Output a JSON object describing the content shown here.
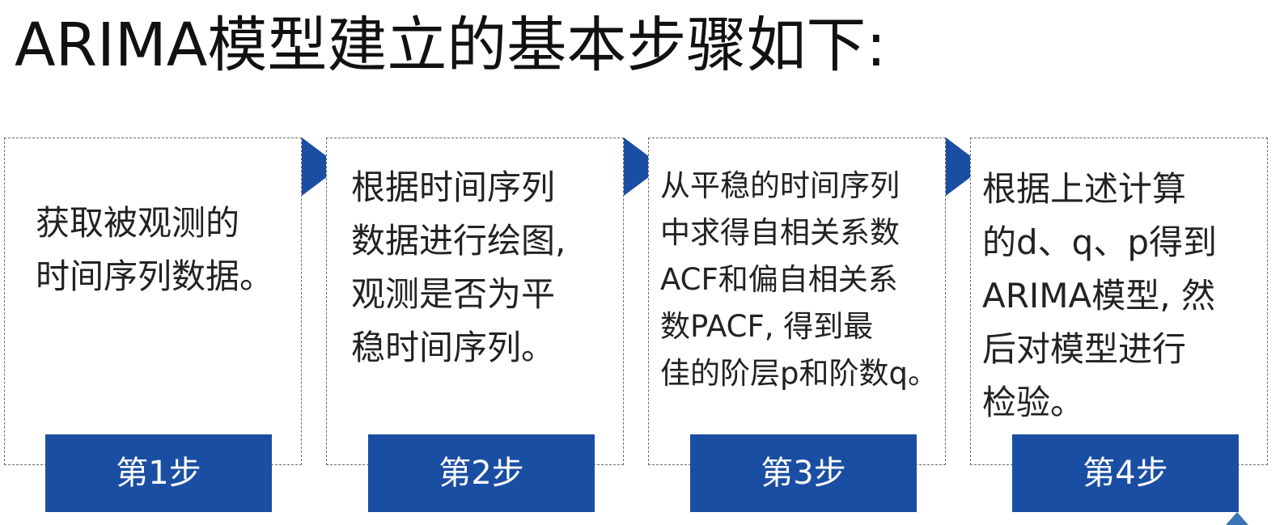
{
  "title": "ARIMA模型建立的基本步骤如下:",
  "steps": [
    {
      "label": "第1步",
      "lines": [
        "获取被观测的",
        "时间序列数据。"
      ]
    },
    {
      "label": "第2步",
      "lines": [
        "根据时间序列",
        "数据进行绘图,",
        "观测是否为平",
        "稳时间序列。"
      ]
    },
    {
      "label": "第3步",
      "lines": [
        "从平稳的时间序列",
        "中求得自相关系数",
        "ACF和偏自相关系",
        "数PACF, 得到最",
        "佳的阶层p和阶数q。"
      ]
    },
    {
      "label": "第4步",
      "lines": [
        "根据上述计算",
        "的d、q、p得到",
        "ARIMA模型, 然",
        "后对模型进行",
        "检验。"
      ]
    }
  ],
  "colors": {
    "accent": "#1a4ea3",
    "box_border": "#6b6b6b",
    "text": "#222222"
  },
  "icons": {
    "connector": "right-triangle-arrow",
    "corner": "triangle-mark-icon"
  }
}
